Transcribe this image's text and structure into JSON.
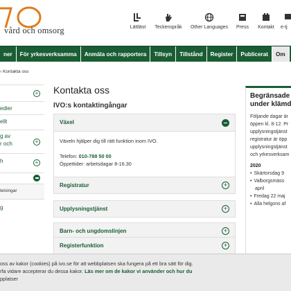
{
  "header": {
    "logo_text": "vård och omsorg",
    "utilities": [
      {
        "label": "Lättläst",
        "icon": "easy-read-icon"
      },
      {
        "label": "Teckenspråk",
        "icon": "sign-language-icon"
      },
      {
        "label": "Other Languages",
        "icon": "globe-icon"
      },
      {
        "label": "Press",
        "icon": "press-icon"
      },
      {
        "label": "Kontakt",
        "icon": "contact-icon"
      },
      {
        "label": "e-tj",
        "icon": "e-service-icon"
      }
    ]
  },
  "nav": {
    "items": [
      "ner",
      "För yrkesverksamma",
      "Anmäla och rapportera",
      "Tillsyn",
      "Tillstånd",
      "Register",
      "Publicerat",
      "Om"
    ],
    "active_index": 7
  },
  "breadcrumb": "› Kontakta oss",
  "sidebar": {
    "items": [
      "edier",
      "ellt",
      "g av",
      "r och",
      "h",
      "telsingar",
      "g"
    ]
  },
  "main": {
    "title": "Kontakta oss",
    "subtitle": "IVO:s kontaktingångar",
    "open_section": {
      "label": "Växel",
      "body": "Växeln hjälper dig till rätt funktion inom IVO.",
      "phone_label": "Telefon:",
      "phone": "010-788 50 00",
      "hours": "Öppettider: arbetsdagar 8-16.30"
    },
    "sections": [
      "Registratur",
      "Upplysningstjänst",
      "Barn- och ungdomslinjen",
      "Registerfunktion"
    ]
  },
  "notice": {
    "title_line1": "Begränsade ö",
    "title_line2": "under klämda",
    "text_lines": [
      "Följande dagar är",
      "öppen kl. 8-12. Pr",
      "upplysningstjänst",
      "registratur är öpp",
      "upplysningstjänst",
      "och yrkesverksam"
    ],
    "year": "2020",
    "dates": [
      "Skärtorsdag 9",
      "Valborgsmäss",
      "april",
      "Fredag 22 maj",
      "Alla helgons af"
    ]
  },
  "cookie": {
    "line1": "oss av kakor (cookies) på ivo.se för att webbplatsen ska fungera på ett bra sätt för dig.",
    "line2_prefix": "rfa vidare accepterar du dessa kakor. ",
    "link": "Läs mer om de kakor vi använder och hur du",
    "line3": "pplatser"
  },
  "colors": {
    "brand_green": "#1a5d34",
    "logo_orange": "#e07b1a"
  }
}
